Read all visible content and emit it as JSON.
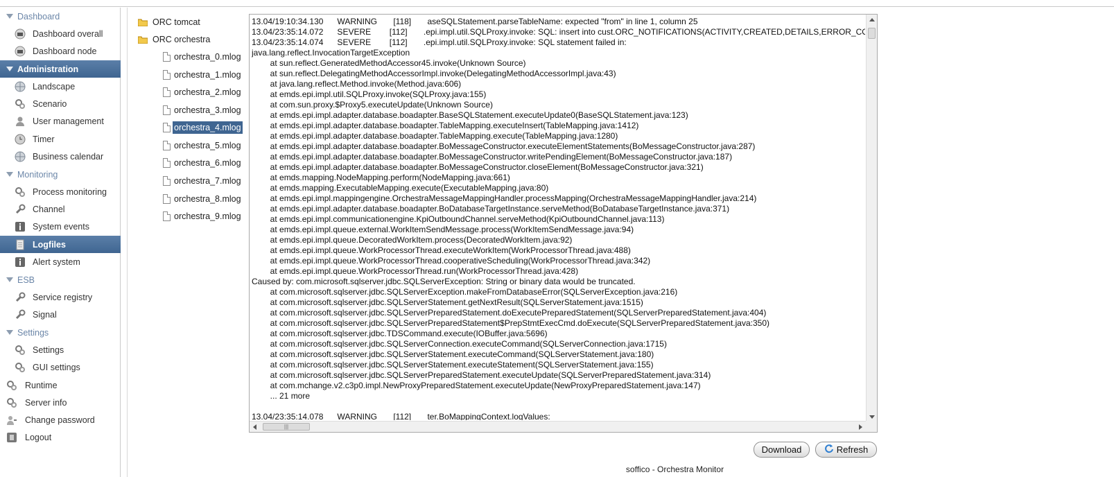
{
  "sidebar": {
    "items": [
      {
        "type": "section",
        "label": "Dashboard",
        "active": false
      },
      {
        "type": "item",
        "label": "Dashboard overall",
        "icon": "dashboard-icon"
      },
      {
        "type": "item",
        "label": "Dashboard node",
        "icon": "dashboard-icon"
      },
      {
        "type": "section",
        "label": "Administration",
        "active": true
      },
      {
        "type": "item",
        "label": "Landscape",
        "icon": "globe-icon"
      },
      {
        "type": "item",
        "label": "Scenario",
        "icon": "gears-icon"
      },
      {
        "type": "item",
        "label": "User management",
        "icon": "user-icon"
      },
      {
        "type": "item",
        "label": "Timer",
        "icon": "clock-icon"
      },
      {
        "type": "item",
        "label": "Business calendar",
        "icon": "globe-icon"
      },
      {
        "type": "section",
        "label": "Monitoring",
        "active": false
      },
      {
        "type": "item",
        "label": "Process monitoring",
        "icon": "gears-icon"
      },
      {
        "type": "item",
        "label": "Channel",
        "icon": "wrench-icon"
      },
      {
        "type": "item",
        "label": "System events",
        "icon": "info-icon"
      },
      {
        "type": "item",
        "label": "Logfiles",
        "icon": "document-icon",
        "active": true
      },
      {
        "type": "item",
        "label": "Alert system",
        "icon": "info-icon"
      },
      {
        "type": "section",
        "label": "ESB",
        "active": false
      },
      {
        "type": "item",
        "label": "Service registry",
        "icon": "wrench-icon"
      },
      {
        "type": "item",
        "label": "Signal",
        "icon": "wrench-icon"
      },
      {
        "type": "section",
        "label": "Settings",
        "active": false
      },
      {
        "type": "item",
        "label": "Settings",
        "icon": "gears-icon"
      },
      {
        "type": "item",
        "label": "GUI settings",
        "icon": "gears-icon"
      },
      {
        "type": "top",
        "label": "Runtime",
        "icon": "gears-icon"
      },
      {
        "type": "top",
        "label": "Server info",
        "icon": "gears-icon"
      },
      {
        "type": "top",
        "label": "Change password",
        "icon": "person-key-icon"
      },
      {
        "type": "top",
        "label": "Logout",
        "icon": "logout-icon"
      }
    ]
  },
  "tree": {
    "folders": [
      {
        "label": "ORC tomcat"
      },
      {
        "label": "ORC orchestra"
      }
    ],
    "files": [
      {
        "label": "orchestra_0.mlog"
      },
      {
        "label": "orchestra_1.mlog"
      },
      {
        "label": "orchestra_2.mlog"
      },
      {
        "label": "orchestra_3.mlog"
      },
      {
        "label": "orchestra_4.mlog",
        "selected": true
      },
      {
        "label": "orchestra_5.mlog"
      },
      {
        "label": "orchestra_6.mlog"
      },
      {
        "label": "orchestra_7.mlog"
      },
      {
        "label": "orchestra_8.mlog"
      },
      {
        "label": "orchestra_9.mlog"
      }
    ]
  },
  "log": {
    "text": "13.04/19:10:34.130      WARNING       [118]       aseSQLStatement.parseTableName: expected \"from\" in line 1, column 25\n13.04/23:35:14.072      SEVERE        [112]       .epi.impl.util.SQLProxy.invoke: SQL: insert into cust.ORC_NOTIFICATIONS(ACTIVITY,CREATED,DETAILS,ERROR_CO\n13.04/23:35:14.074      SEVERE        [112]       .epi.impl.util.SQLProxy.invoke: SQL statement failed in:\njava.lang.reflect.InvocationTargetException\n        at sun.reflect.GeneratedMethodAccessor45.invoke(Unknown Source)\n        at sun.reflect.DelegatingMethodAccessorImpl.invoke(DelegatingMethodAccessorImpl.java:43)\n        at java.lang.reflect.Method.invoke(Method.java:606)\n        at emds.epi.impl.util.SQLProxy.invoke(SQLProxy.java:155)\n        at com.sun.proxy.$Proxy5.executeUpdate(Unknown Source)\n        at emds.epi.impl.adapter.database.boadapter.BaseSQLStatement.executeUpdate0(BaseSQLStatement.java:123)\n        at emds.epi.impl.adapter.database.boadapter.TableMapping.executeInsert(TableMapping.java:1412)\n        at emds.epi.impl.adapter.database.boadapter.TableMapping.execute(TableMapping.java:1280)\n        at emds.epi.impl.adapter.database.boadapter.BoMessageConstructor.executeElementStatements(BoMessageConstructor.java:287)\n        at emds.epi.impl.adapter.database.boadapter.BoMessageConstructor.writePendingElement(BoMessageConstructor.java:187)\n        at emds.epi.impl.adapter.database.boadapter.BoMessageConstructor.closeElement(BoMessageConstructor.java:321)\n        at emds.mapping.NodeMapping.perform(NodeMapping.java:661)\n        at emds.mapping.ExecutableMapping.execute(ExecutableMapping.java:80)\n        at emds.epi.impl.mappingengine.OrchestraMessageMappingHandler.processMapping(OrchestraMessageMappingHandler.java:214)\n        at emds.epi.impl.adapter.database.boadapter.BoDatabaseTargetInstance.serveMethod(BoDatabaseTargetInstance.java:371)\n        at emds.epi.impl.communicationengine.KpiOutboundChannel.serveMethod(KpiOutboundChannel.java:113)\n        at emds.epi.impl.queue.external.WorkItemSendMessage.process(WorkItemSendMessage.java:94)\n        at emds.epi.impl.queue.DecoratedWorkItem.process(DecoratedWorkItem.java:92)\n        at emds.epi.impl.queue.WorkProcessorThread.executeWorkItem(WorkProcessorThread.java:488)\n        at emds.epi.impl.queue.WorkProcessorThread.cooperativeScheduling(WorkProcessorThread.java:342)\n        at emds.epi.impl.queue.WorkProcessorThread.run(WorkProcessorThread.java:428)\nCaused by: com.microsoft.sqlserver.jdbc.SQLServerException: String or binary data would be truncated.\n        at com.microsoft.sqlserver.jdbc.SQLServerException.makeFromDatabaseError(SQLServerException.java:216)\n        at com.microsoft.sqlserver.jdbc.SQLServerStatement.getNextResult(SQLServerStatement.java:1515)\n        at com.microsoft.sqlserver.jdbc.SQLServerPreparedStatement.doExecutePreparedStatement(SQLServerPreparedStatement.java:404)\n        at com.microsoft.sqlserver.jdbc.SQLServerPreparedStatement$PrepStmtExecCmd.doExecute(SQLServerPreparedStatement.java:350)\n        at com.microsoft.sqlserver.jdbc.TDSCommand.execute(IOBuffer.java:5696)\n        at com.microsoft.sqlserver.jdbc.SQLServerConnection.executeCommand(SQLServerConnection.java:1715)\n        at com.microsoft.sqlserver.jdbc.SQLServerStatement.executeCommand(SQLServerStatement.java:180)\n        at com.microsoft.sqlserver.jdbc.SQLServerStatement.executeStatement(SQLServerStatement.java:155)\n        at com.microsoft.sqlserver.jdbc.SQLServerPreparedStatement.executeUpdate(SQLServerPreparedStatement.java:314)\n        at com.mchange.v2.c3p0.impl.NewProxyPreparedStatement.executeUpdate(NewProxyPreparedStatement.java:147)\n        ... 21 more\n\n13.04/23:35:14.078      WARNING       [112]       ter.BoMappingContext.logValues:"
  },
  "buttons": {
    "download": "Download",
    "refresh": "Refresh"
  },
  "footer": {
    "text": "soffico - Orchestra Monitor"
  },
  "colors": {
    "accent": "#3f6591",
    "section_text": "#6b86a8"
  }
}
